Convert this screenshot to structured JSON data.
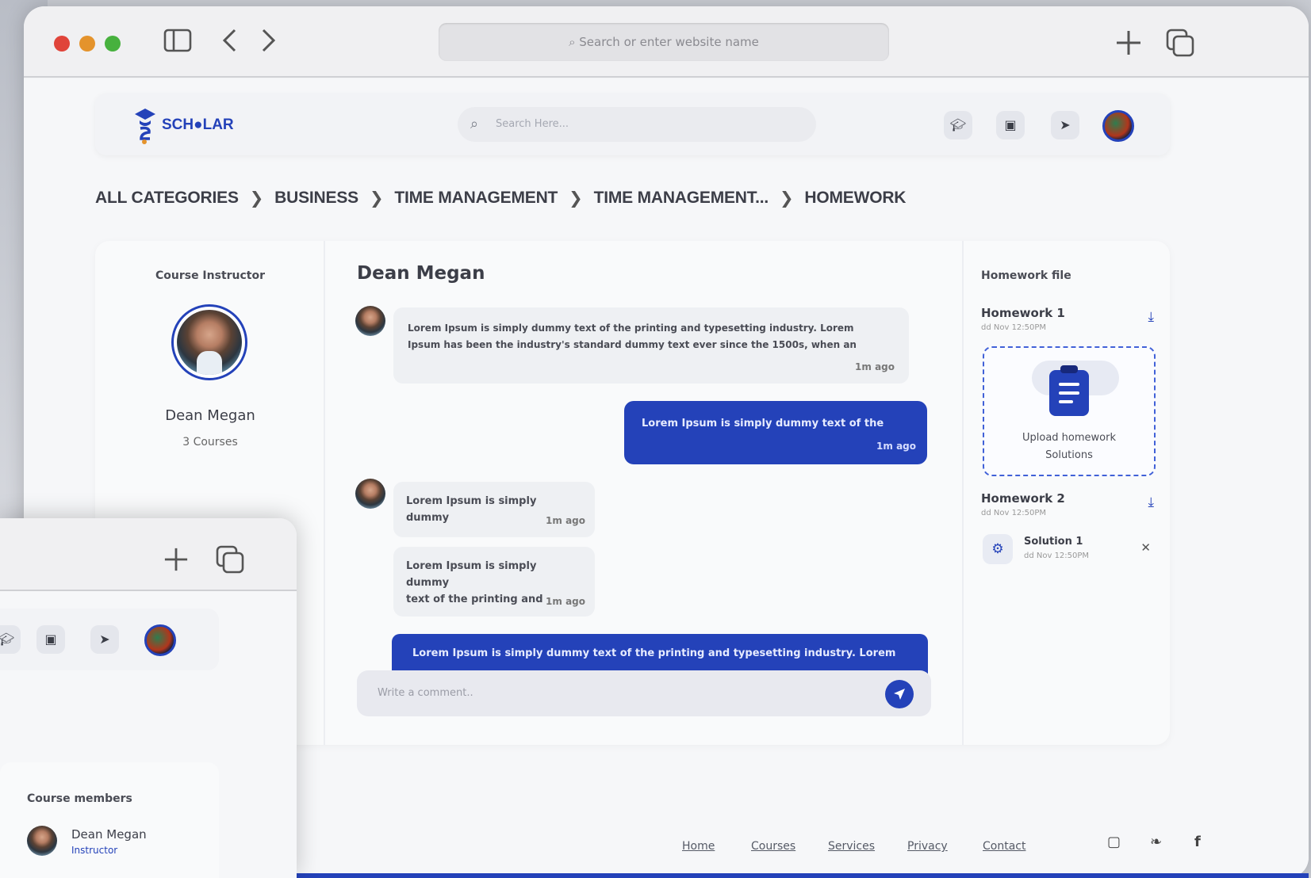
{
  "browser": {
    "url_placeholder": "Search or enter website name"
  },
  "brand": {
    "logo_text": "SCH●LAR"
  },
  "nav": {
    "search_placeholder": "Search Here..."
  },
  "breadcrumb": [
    "ALL CATEGORIES",
    "BUSINESS",
    "TIME MANAGEMENT",
    "TIME MANAGEMENT...",
    "HOMEWORK"
  ],
  "instructor": {
    "section_title": "Course Instructor",
    "name": "Dean Megan",
    "courses": "3 Courses"
  },
  "chat": {
    "title": "Dean Megan",
    "messages": [
      {
        "side": "left",
        "text1": "Lorem Ipsum is simply dummy text of the printing and typesetting industry. Lorem",
        "text2": "Ipsum has been the industry's standard dummy text ever since the 1500s, when an",
        "time": "1m ago"
      },
      {
        "side": "right",
        "text1": "Lorem Ipsum is simply dummy text of the",
        "time": "1m ago"
      },
      {
        "side": "left",
        "text1": "Lorem Ipsum is simply dummy",
        "time": "1m ago"
      },
      {
        "side": "left",
        "text1": "Lorem Ipsum is simply dummy",
        "text2": "text of the printing and",
        "time": "1m ago"
      },
      {
        "side": "right",
        "text1": "Lorem Ipsum is simply dummy text of the printing and typesetting industry. Lorem"
      }
    ],
    "comment_placeholder": "Write a comment.."
  },
  "homework": {
    "title": "Homework file",
    "items": [
      {
        "name": "Homework 1",
        "date": "dd Nov 12:50PM"
      },
      {
        "name": "Homework 2",
        "date": "dd Nov 12:50PM"
      }
    ],
    "upload_label_1": "Upload homework",
    "upload_label_2": "Solutions",
    "solution": {
      "name": "Solution 1",
      "date": "dd Nov 12:50PM"
    }
  },
  "overlay": {
    "members_title": "Course members",
    "member_name": "Dean Megan",
    "member_role": "Instructor"
  },
  "footer": {
    "links": [
      "Home",
      "Courses",
      "Services",
      "Privacy",
      "Contact"
    ]
  },
  "colors": {
    "accent": "#2442b9",
    "bubble": "#eef0f3"
  },
  "icons": [
    "sidebar-icon",
    "back-icon",
    "forward-icon",
    "plus-icon",
    "tabs-icon",
    "search-icon",
    "graduation-cap-icon",
    "briefcase-icon",
    "cursor-icon",
    "download-icon",
    "clipboard-icon",
    "send-icon",
    "close-icon",
    "instagram-icon",
    "twitter-icon",
    "facebook-icon"
  ]
}
